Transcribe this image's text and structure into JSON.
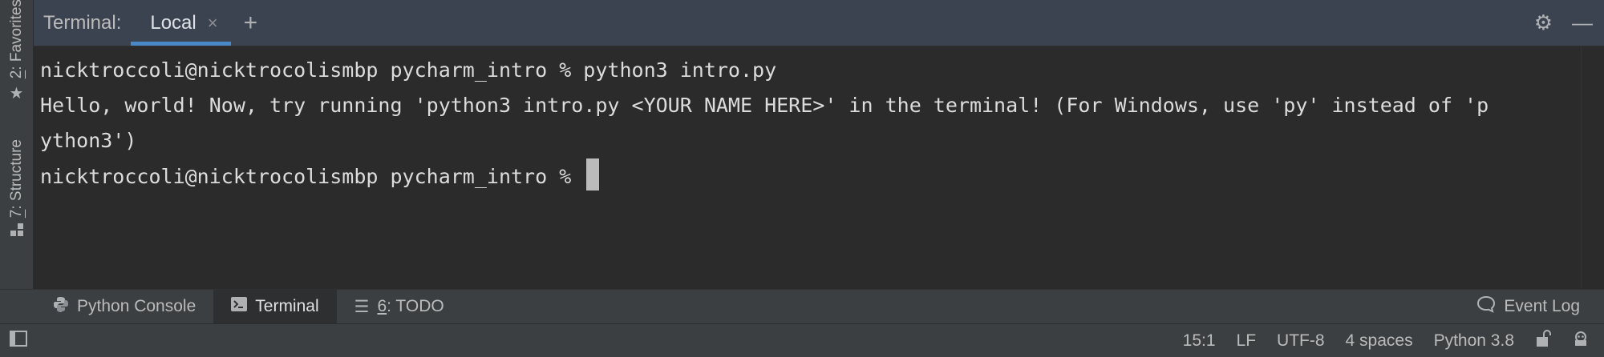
{
  "left_strip": {
    "favorites_label": "Favorites",
    "favorites_num": "2",
    "structure_label": "Structure",
    "structure_num": "7"
  },
  "terminal_header": {
    "title": "Terminal:",
    "tabs": [
      {
        "label": "Local",
        "close": "×"
      }
    ],
    "add": "+"
  },
  "terminal": {
    "lines": [
      "nicktroccoli@nicktrocolismbp pycharm_intro % python3 intro.py",
      "Hello, world! Now, try running 'python3 intro.py <YOUR NAME HERE>' in the terminal! (For Windows, use 'py' instead of 'p",
      "ython3')",
      "nicktroccoli@nicktrocolismbp pycharm_intro % "
    ]
  },
  "tool_windows": {
    "python_console": "Python Console",
    "terminal": "Terminal",
    "todo_num": "6",
    "todo_label": ": TODO",
    "event_log": "Event Log"
  },
  "status_bar": {
    "position": "15:1",
    "line_separator": "LF",
    "encoding": "UTF-8",
    "indent": "4 spaces",
    "interpreter": "Python 3.8"
  },
  "colors": {
    "accent": "#4a88c7",
    "terminal_bg": "#2b2b2b",
    "header_bg": "#3c4350",
    "panel_bg": "#3c3f41"
  },
  "icons": [
    "star-icon",
    "structure-icon",
    "gear-icon",
    "minimize-icon",
    "python-icon",
    "terminal-icon",
    "list-icon",
    "speech-bubble-icon",
    "panel-toggle-icon",
    "lock-icon",
    "inspector-icon",
    "close-icon",
    "add-icon"
  ]
}
